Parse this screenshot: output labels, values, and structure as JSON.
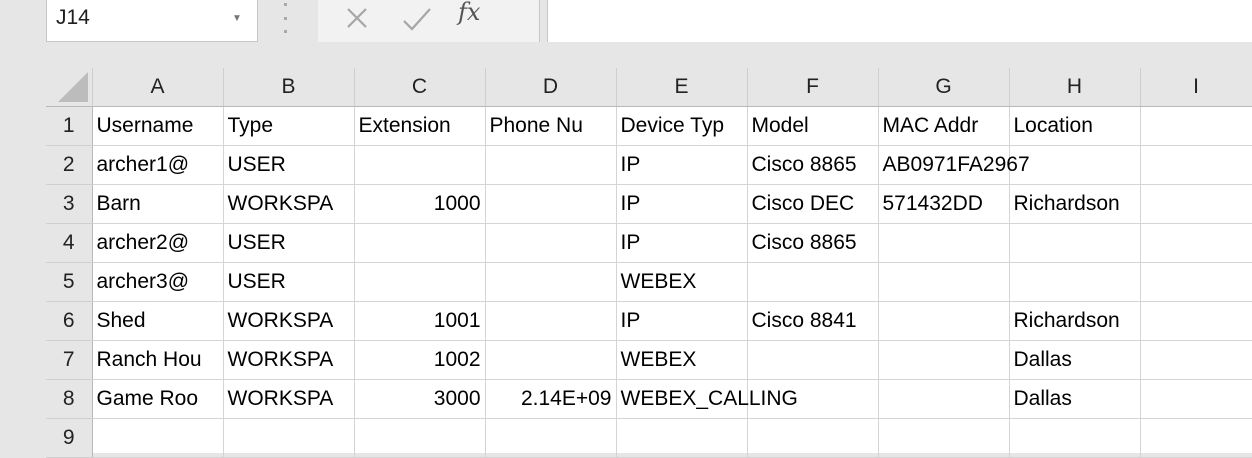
{
  "name_box": {
    "value": "J14"
  },
  "formula_bar": {
    "cancel_icon": "close-icon",
    "enter_icon": "check-icon",
    "fx_icon": "fx-icon",
    "fx_label": "fx",
    "value": ""
  },
  "columns": [
    "A",
    "B",
    "C",
    "D",
    "E",
    "F",
    "G",
    "H",
    "I"
  ],
  "rows": [
    {
      "num": "1",
      "cells": [
        "Username",
        "Type",
        "Extension",
        "Phone Nu",
        "Device Typ",
        "Model",
        "MAC Addr",
        "Location",
        ""
      ]
    },
    {
      "num": "2",
      "cells": [
        "archer1@",
        "USER",
        "",
        "",
        "IP",
        "Cisco 8865",
        "AB0971FA2967",
        "",
        ""
      ]
    },
    {
      "num": "3",
      "cells": [
        "Barn",
        "WORKSPA",
        "1000",
        "",
        "IP",
        "Cisco DEC",
        "571432DD",
        "Richardson",
        ""
      ]
    },
    {
      "num": "4",
      "cells": [
        "archer2@",
        "USER",
        "",
        "",
        "IP",
        "Cisco 8865",
        "",
        "",
        ""
      ]
    },
    {
      "num": "5",
      "cells": [
        "archer3@",
        "USER",
        "",
        "",
        "WEBEX",
        "",
        "",
        "",
        ""
      ]
    },
    {
      "num": "6",
      "cells": [
        "Shed",
        "WORKSPA",
        "1001",
        "",
        "IP",
        "Cisco 8841",
        "",
        "Richardson",
        ""
      ]
    },
    {
      "num": "7",
      "cells": [
        "Ranch Hou",
        "WORKSPA",
        "1002",
        "",
        "WEBEX",
        "",
        "",
        "Dallas",
        ""
      ]
    },
    {
      "num": "8",
      "cells": [
        "Game Roo",
        "WORKSPA",
        "3000",
        "2.14E+09",
        "WEBEX_CALLING",
        "",
        "",
        "Dallas",
        ""
      ]
    },
    {
      "num": "9",
      "cells": [
        "",
        "",
        "",
        "",
        "",
        "",
        "",
        "",
        ""
      ]
    }
  ]
}
